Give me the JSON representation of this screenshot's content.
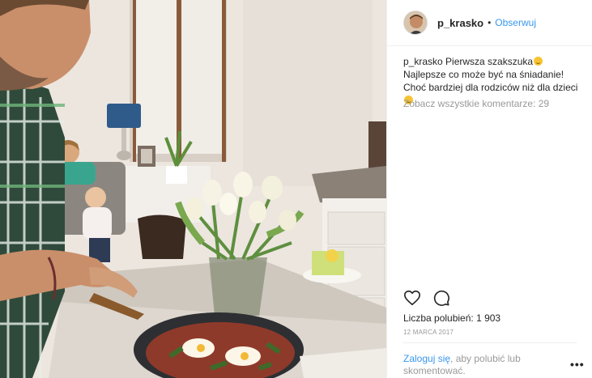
{
  "post": {
    "username": "p_krasko",
    "separator": "•",
    "follow_label": "Obserwuj",
    "caption_user": "p_krasko",
    "caption_part1": "Pierwsza szakszuka",
    "caption_part2": " Najlepsze co może być na śniadanie! Choć bardziej dla rodziców niż dla dzieci",
    "view_comments": "Zobacz wszystkie komentarze: 29",
    "likes": "Liczba polubień: 1 903",
    "date": "12 marca 2017",
    "login_link": "Zaloguj się",
    "login_rest": ", aby polubić lub skomentować.",
    "more_label": "•••"
  },
  "icons": {
    "like": "heart-icon",
    "comment": "comment-icon",
    "emoji": "smiley-emoji-icon",
    "more": "more-options-icon"
  },
  "colors": {
    "link_blue": "#3897f0",
    "text": "#262626",
    "muted": "#999999",
    "border": "#efefef"
  }
}
